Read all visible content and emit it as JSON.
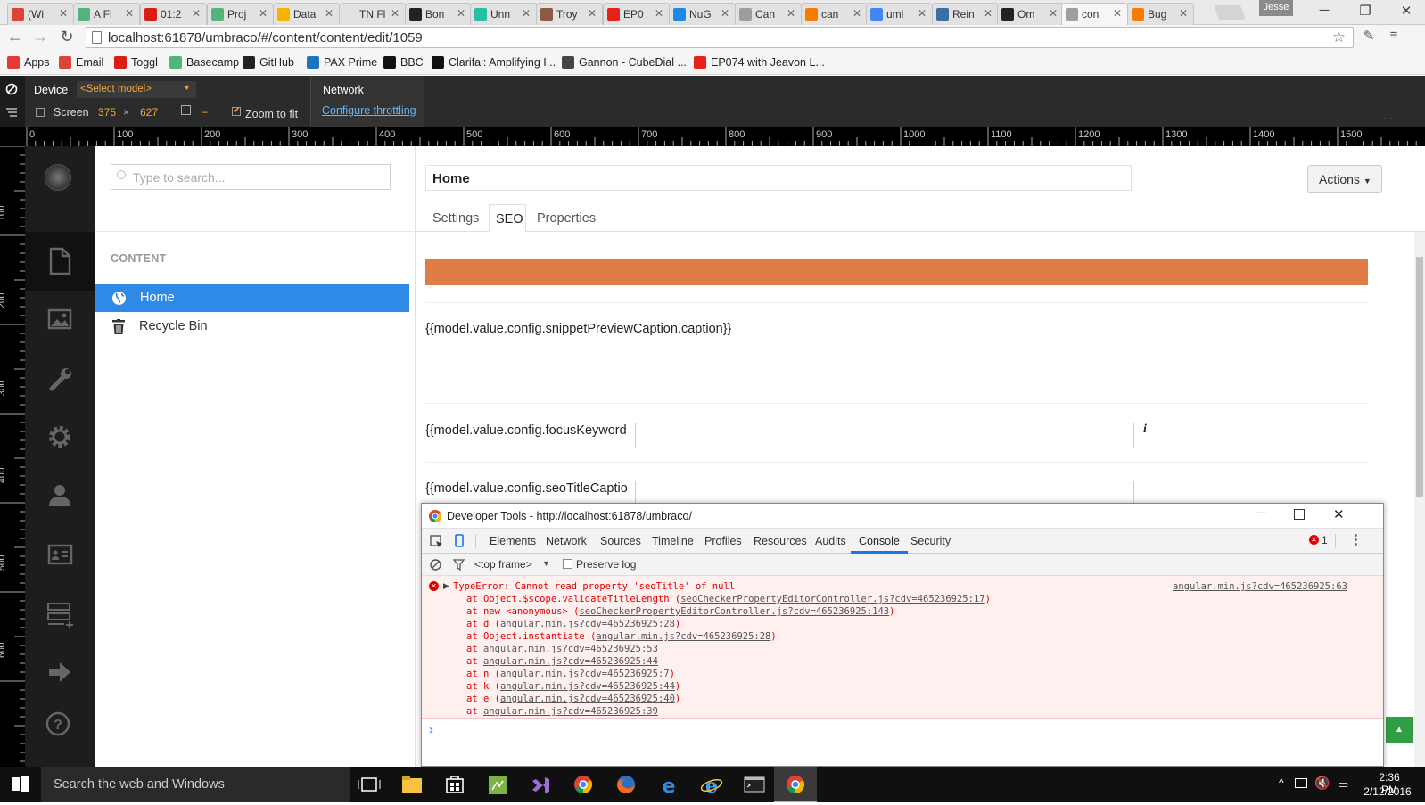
{
  "browser": {
    "tabs": [
      {
        "label": "(Wi",
        "color": "#db4437"
      },
      {
        "label": "A Fi",
        "color": "#55b37c"
      },
      {
        "label": "01:2",
        "color": "#d91e18"
      },
      {
        "label": "Proj",
        "color": "#55b37c"
      },
      {
        "label": "Data",
        "color": "#f4b400"
      },
      {
        "label": "TN Flus",
        "color": ""
      },
      {
        "label": "Bon",
        "color": "#222222"
      },
      {
        "label": "Unn",
        "color": "#25c2a0"
      },
      {
        "label": "Troy",
        "color": "#8a5a44"
      },
      {
        "label": "EP0",
        "color": "#e62117"
      },
      {
        "label": "NuG",
        "color": "#1e88e5"
      },
      {
        "label": "Can",
        "color": "#9e9e9e"
      },
      {
        "label": "can",
        "color": "#f57c00"
      },
      {
        "label": "uml",
        "color": "#4285f4"
      },
      {
        "label": "Rein",
        "color": "#3b6ea5"
      },
      {
        "label": "Om",
        "color": "#222222"
      },
      {
        "label": "con",
        "color": "#9e9e9e"
      },
      {
        "label": "Bug",
        "color": "#f57c00"
      }
    ],
    "active_tab_index": 16,
    "user_name": "Jesse",
    "url_host": "localhost",
    "url_rest": ":61878/umbraco/#/content/content/edit/1059",
    "bookmarks": [
      {
        "label": "Apps",
        "color": "#e53935"
      },
      {
        "label": "Email",
        "color": "#db4437"
      },
      {
        "label": "Toggl",
        "color": "#d91e18"
      },
      {
        "label": "Basecamp",
        "color": "#55b37c"
      },
      {
        "label": "GitHub",
        "color": "#222222"
      },
      {
        "label": "PAX Prime",
        "color": "#1e73be"
      },
      {
        "label": "BBC",
        "color": "#111111"
      },
      {
        "label": "Clarifai: Amplifying I...",
        "color": "#111111"
      },
      {
        "label": "Gannon - CubeDial ...",
        "color": "#444444"
      },
      {
        "label": "EP074 with Jeavon L...",
        "color": "#e62117"
      }
    ]
  },
  "device_mode": {
    "device_label": "Device",
    "model_placeholder": "<Select model>",
    "screen_label": "Screen",
    "width": "375",
    "times": "×",
    "height": "627",
    "dash": "–",
    "zoom_label": "Zoom to fit",
    "network_label": "Network",
    "throttling_link": "Configure throttling",
    "ruler_ticks": [
      "0",
      "100",
      "200",
      "300",
      "400",
      "500",
      "600",
      "700",
      "800",
      "900",
      "1000",
      "1100",
      "1200",
      "1300",
      "1400",
      "1500"
    ],
    "vruler_ticks": [
      "100",
      "200",
      "300",
      "400",
      "500",
      "600"
    ]
  },
  "umbraco": {
    "search_placeholder": "Type to search...",
    "section_heading": "CONTENT",
    "tree_items": [
      {
        "label": "Home",
        "icon": "globe-icon",
        "selected": true
      },
      {
        "label": "Recycle Bin",
        "icon": "trash-icon",
        "selected": false
      }
    ],
    "node_name": "Home",
    "actions_label": "Actions",
    "tabs": [
      "Settings",
      "SEO",
      "Properties"
    ],
    "active_tab": "SEO",
    "accent_color": "#e07d46",
    "nav_accent": "#f36f21",
    "selected_color": "#2e8ae6",
    "snippet_caption": "{{model.value.config.snippetPreviewCaption.caption}}",
    "focus_keyword_label": "{{model.value.config.focusKeyword",
    "info_icon": "i",
    "seo_title_label": "{{model.value.config.seoTitleCaptio"
  },
  "devtools": {
    "title": "Developer Tools - http://localhost:61878/umbraco/",
    "panels": [
      "Elements",
      "Network",
      "Sources",
      "Timeline",
      "Profiles",
      "Resources",
      "Audits",
      "Console",
      "Security"
    ],
    "active_panel": "Console",
    "error_count": "1",
    "frame_select": "<top frame>",
    "preserve_log": "Preserve log",
    "error_message": "TypeError: Cannot read property 'seoTitle' of null",
    "error_source": "angular.min.js?cdv=465236925:63",
    "stack": [
      {
        "pre": "at Object.$scope.validateTitleLength (",
        "link": "seoCheckerPropertyEditorController.js?cdv=465236925:17",
        "post": ")"
      },
      {
        "pre": "at new <anonymous> (",
        "link": "seoCheckerPropertyEditorController.js?cdv=465236925:143",
        "post": ")"
      },
      {
        "pre": "at d (",
        "link": "angular.min.js?cdv=465236925:28",
        "post": ")"
      },
      {
        "pre": "at Object.instantiate (",
        "link": "angular.min.js?cdv=465236925:28",
        "post": ")"
      },
      {
        "pre": "at ",
        "link": "angular.min.js?cdv=465236925:53",
        "post": ""
      },
      {
        "pre": "at ",
        "link": "angular.min.js?cdv=465236925:44",
        "post": ""
      },
      {
        "pre": "at n (",
        "link": "angular.min.js?cdv=465236925:7",
        "post": ")"
      },
      {
        "pre": "at k (",
        "link": "angular.min.js?cdv=465236925:44",
        "post": ")"
      },
      {
        "pre": "at e (",
        "link": "angular.min.js?cdv=465236925:40",
        "post": ")"
      },
      {
        "pre": "at ",
        "link": "angular.min.js?cdv=465236925:39",
        "post": ""
      }
    ],
    "prompt": "›"
  },
  "taskbar": {
    "search_placeholder": "Search the web and Windows",
    "time": "2:36 PM",
    "date": "2/12/2016"
  }
}
